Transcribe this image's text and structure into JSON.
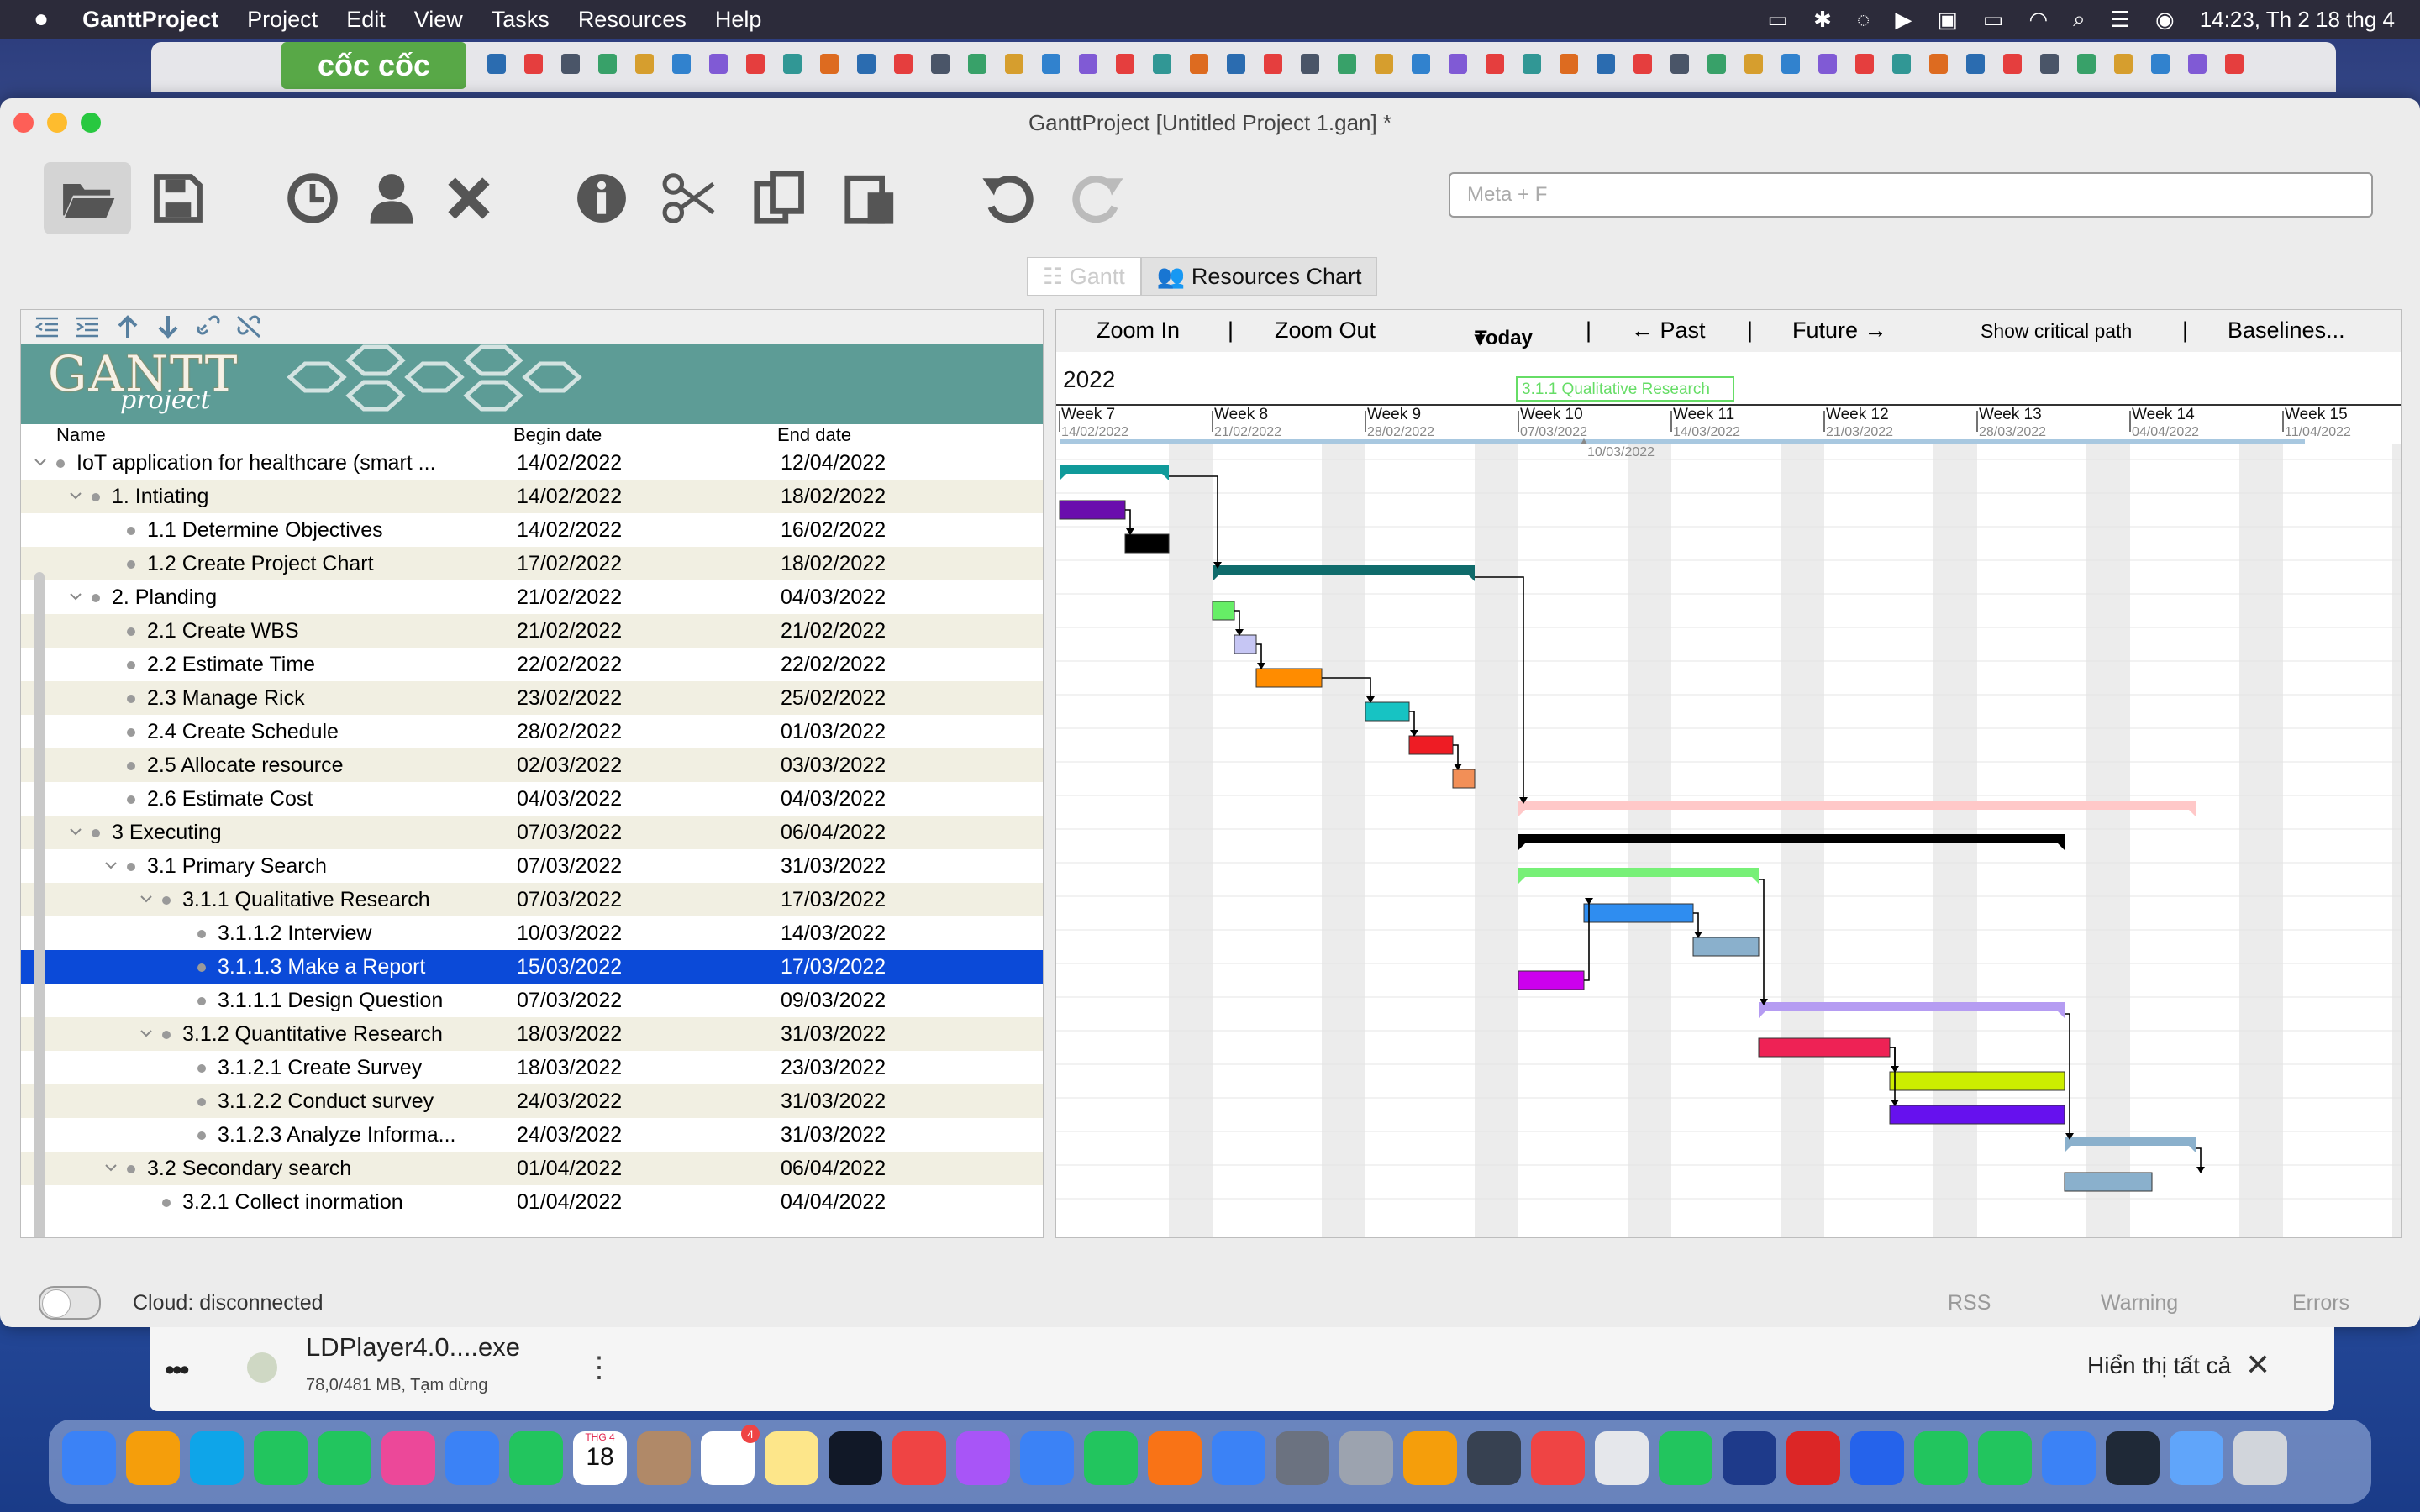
{
  "menubar": {
    "app": "GanttProject",
    "items": [
      "Project",
      "Edit",
      "View",
      "Tasks",
      "Resources",
      "Help"
    ],
    "clock": "14:23, Th 2 18 thg 4"
  },
  "browser": {
    "brand": "cốc cốc"
  },
  "window": {
    "title": "GanttProject [Untitled Project 1.gan] *",
    "search_placeholder": "Meta + F"
  },
  "view_tabs": {
    "gantt": "Gantt",
    "resources": "Resources Chart"
  },
  "logo": {
    "name": "GANTT",
    "sub": "project"
  },
  "columns": {
    "name": "Name",
    "begin": "Begin date",
    "end": "End date"
  },
  "tasks": [
    {
      "name": "IoT application for healthcare (smart ...",
      "begin": "14/02/2022",
      "end": "12/04/2022",
      "level": 0,
      "group": true
    },
    {
      "name": "1. Intiating",
      "begin": "14/02/2022",
      "end": "18/02/2022",
      "level": 1,
      "group": true
    },
    {
      "name": "1.1 Determine Objectives",
      "begin": "14/02/2022",
      "end": "16/02/2022",
      "level": 2,
      "group": false
    },
    {
      "name": "1.2 Create Project Chart",
      "begin": "17/02/2022",
      "end": "18/02/2022",
      "level": 2,
      "group": false
    },
    {
      "name": "2. Planding",
      "begin": "21/02/2022",
      "end": "04/03/2022",
      "level": 1,
      "group": true
    },
    {
      "name": "2.1 Create WBS",
      "begin": "21/02/2022",
      "end": "21/02/2022",
      "level": 2,
      "group": false
    },
    {
      "name": "2.2 Estimate Time",
      "begin": "22/02/2022",
      "end": "22/02/2022",
      "level": 2,
      "group": false
    },
    {
      "name": "2.3 Manage Rick",
      "begin": "23/02/2022",
      "end": "25/02/2022",
      "level": 2,
      "group": false
    },
    {
      "name": "2.4 Create Schedule",
      "begin": "28/02/2022",
      "end": "01/03/2022",
      "level": 2,
      "group": false
    },
    {
      "name": "2.5 Allocate resource",
      "begin": "02/03/2022",
      "end": "03/03/2022",
      "level": 2,
      "group": false
    },
    {
      "name": "2.6 Estimate Cost",
      "begin": "04/03/2022",
      "end": "04/03/2022",
      "level": 2,
      "group": false
    },
    {
      "name": "3 Executing",
      "begin": "07/03/2022",
      "end": "06/04/2022",
      "level": 1,
      "group": true
    },
    {
      "name": "3.1 Primary Search",
      "begin": "07/03/2022",
      "end": "31/03/2022",
      "level": 2,
      "group": true
    },
    {
      "name": "3.1.1 Qualitative Research",
      "begin": "07/03/2022",
      "end": "17/03/2022",
      "level": 3,
      "group": true
    },
    {
      "name": "3.1.1.2 Interview",
      "begin": "10/03/2022",
      "end": "14/03/2022",
      "level": 4,
      "group": false
    },
    {
      "name": "3.1.1.3 Make a Report",
      "begin": "15/03/2022",
      "end": "17/03/2022",
      "level": 4,
      "group": false,
      "selected": true
    },
    {
      "name": "3.1.1.1 Design Question",
      "begin": "07/03/2022",
      "end": "09/03/2022",
      "level": 4,
      "group": false
    },
    {
      "name": "3.1.2 Quantitative Research",
      "begin": "18/03/2022",
      "end": "31/03/2022",
      "level": 3,
      "group": true
    },
    {
      "name": "3.1.2.1 Create Survey",
      "begin": "18/03/2022",
      "end": "23/03/2022",
      "level": 4,
      "group": false
    },
    {
      "name": "3.1.2.2 Conduct survey",
      "begin": "24/03/2022",
      "end": "31/03/2022",
      "level": 4,
      "group": false
    },
    {
      "name": "3.1.2.3 Analyze Informa...",
      "begin": "24/03/2022",
      "end": "31/03/2022",
      "level": 4,
      "group": false
    },
    {
      "name": "3.2  Secondary search",
      "begin": "01/04/2022",
      "end": "06/04/2022",
      "level": 2,
      "group": true
    },
    {
      "name": "3.2.1 Collect inormation",
      "begin": "01/04/2022",
      "end": "04/04/2022",
      "level": 3,
      "group": false
    }
  ],
  "gantt_toolbar": {
    "zoom_in": "Zoom In",
    "zoom_out": "Zoom Out",
    "today": "Today",
    "past": "← Past",
    "future": "Future →",
    "critical": "Show critical path",
    "baselines": "Baselines..."
  },
  "timeline": {
    "year": "2022",
    "weeks": [
      {
        "label": "Week 7",
        "date": "14/02/2022"
      },
      {
        "label": "Week 8",
        "date": "21/02/2022"
      },
      {
        "label": "Week 9",
        "date": "28/02/2022"
      },
      {
        "label": "Week 10",
        "date": "07/03/2022"
      },
      {
        "label": "Week 11",
        "date": "14/03/2022"
      },
      {
        "label": "Week 12",
        "date": "21/03/2022"
      },
      {
        "label": "Week 13",
        "date": "28/03/2022"
      },
      {
        "label": "Week 14",
        "date": "04/04/2022"
      },
      {
        "label": "Week 15",
        "date": "11/04/2022"
      }
    ],
    "today_marker": "10/03/2022",
    "hover_label": "3.1.1 Qualitative Research"
  },
  "chart_data": {
    "type": "gantt",
    "start": "14/02/2022",
    "bars": [
      {
        "row": 1,
        "from": 0,
        "to": 5,
        "summary": true,
        "color": "#109a9a"
      },
      {
        "row": 2,
        "from": 0,
        "to": 3,
        "color": "#6a0dad"
      },
      {
        "row": 3,
        "from": 3,
        "to": 5,
        "color": "#000000"
      },
      {
        "row": 4,
        "from": 7,
        "to": 19,
        "summary": true,
        "color": "#0f6b6b"
      },
      {
        "row": 5,
        "from": 7,
        "to": 8,
        "color": "#66ee66"
      },
      {
        "row": 6,
        "from": 8,
        "to": 9,
        "color": "#c6c6f4"
      },
      {
        "row": 7,
        "from": 9,
        "to": 12,
        "color": "#ff8c00"
      },
      {
        "row": 8,
        "from": 14,
        "to": 16,
        "color": "#17c3c3"
      },
      {
        "row": 9,
        "from": 16,
        "to": 18,
        "color": "#ee1c24"
      },
      {
        "row": 10,
        "from": 18,
        "to": 19,
        "color": "#f28f57"
      },
      {
        "row": 11,
        "from": 21,
        "to": 52,
        "summary": true,
        "color": "#ffc8c8"
      },
      {
        "row": 12,
        "from": 21,
        "to": 46,
        "summary": true,
        "color": "#000000"
      },
      {
        "row": 13,
        "from": 21,
        "to": 32,
        "summary": true,
        "color": "#77f077"
      },
      {
        "row": 14,
        "from": 24,
        "to": 29,
        "color": "#2f8df0"
      },
      {
        "row": 15,
        "from": 29,
        "to": 32,
        "color": "#8ab0cc"
      },
      {
        "row": 16,
        "from": 21,
        "to": 24,
        "color": "#cc00ee"
      },
      {
        "row": 17,
        "from": 32,
        "to": 46,
        "summary": true,
        "color": "#b59cf2"
      },
      {
        "row": 18,
        "from": 32,
        "to": 38,
        "color": "#ee2255"
      },
      {
        "row": 19,
        "from": 38,
        "to": 46,
        "color": "#ccee00"
      },
      {
        "row": 20,
        "from": 38,
        "to": 46,
        "color": "#6611ee"
      },
      {
        "row": 21,
        "from": 46,
        "to": 52,
        "summary": true,
        "color": "#8ab0cc"
      },
      {
        "row": 22,
        "from": 46,
        "to": 50,
        "color": "#8ab0cc"
      }
    ]
  },
  "status": {
    "cloud": "Cloud: disconnected",
    "rss": "RSS",
    "warning": "Warning",
    "errors": "Errors"
  },
  "download": {
    "file": "LDPlayer4.0....exe",
    "progress": "78,0/481 MB, Tạm dừng",
    "show_all": "Hiển thị tất cả"
  },
  "dock": {
    "calendar_month": "THG 4",
    "calendar_day": "18",
    "reminders_badge": "4"
  }
}
